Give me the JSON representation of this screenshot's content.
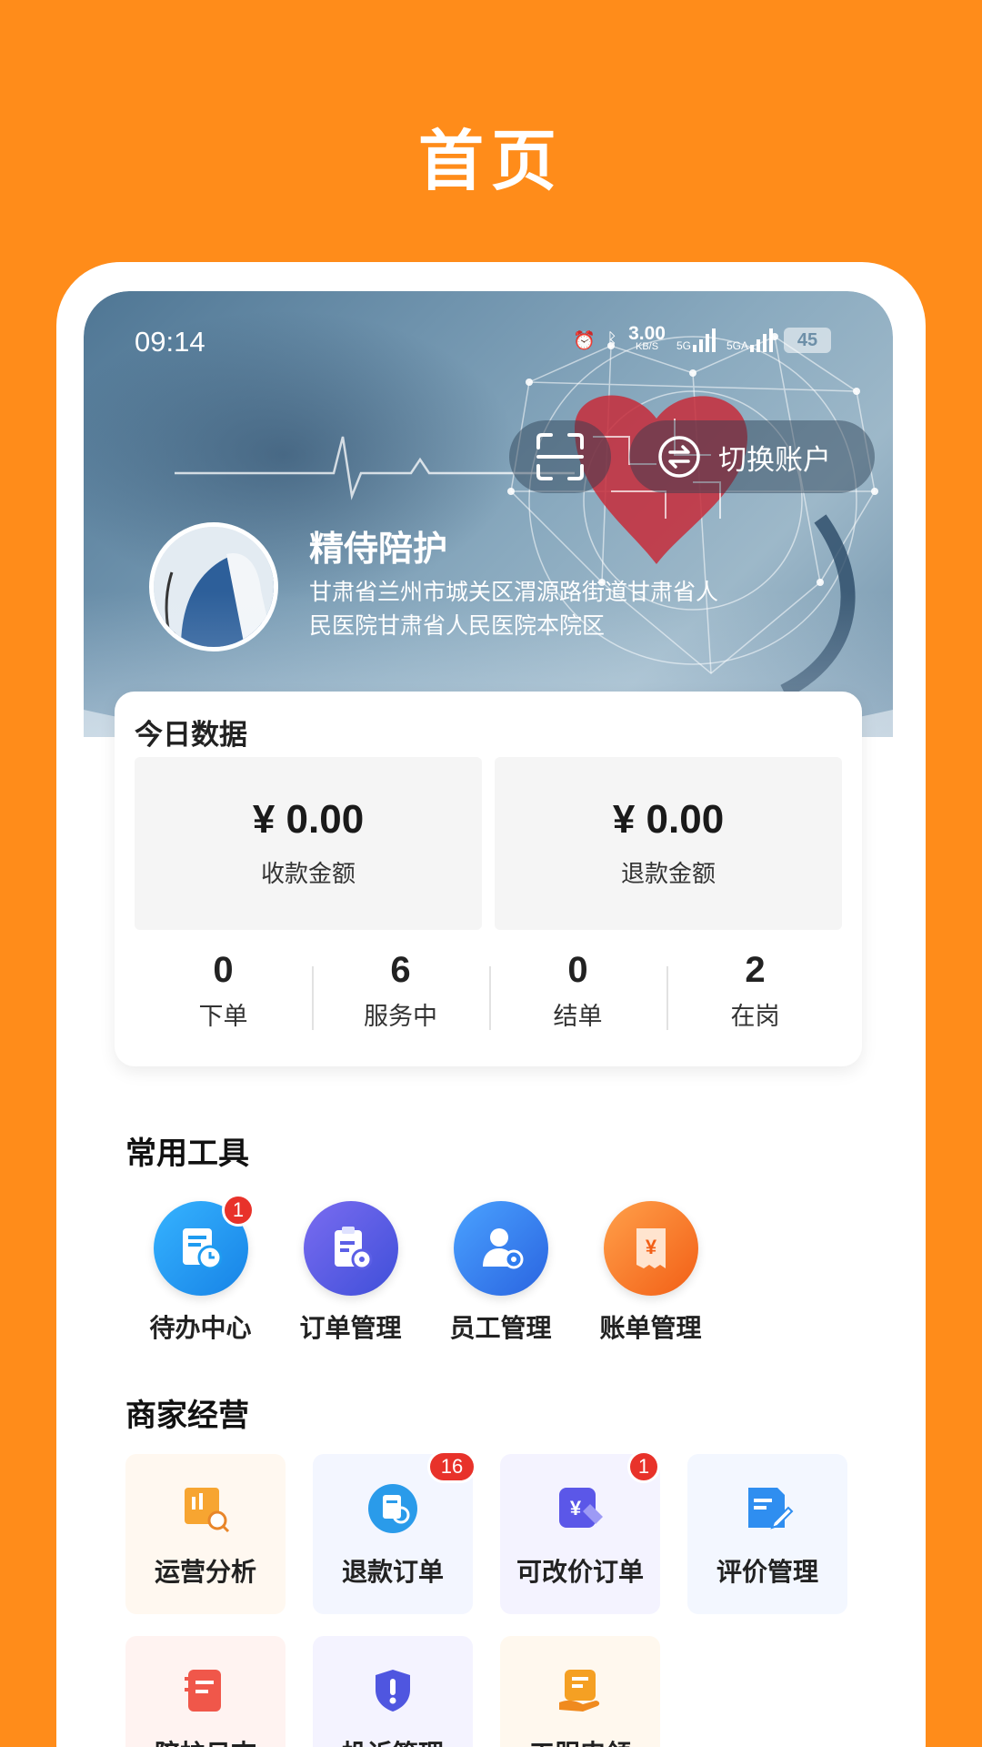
{
  "page": {
    "title": "首页"
  },
  "status_bar": {
    "time": "09:14",
    "speed": "3.00",
    "speed_unit": "KB/S",
    "net1": "5G",
    "net2": "5GA",
    "battery": "45"
  },
  "header": {
    "switch_account_label": "切换账户"
  },
  "shop": {
    "name": "精侍陪护",
    "address": "甘肃省兰州市城关区渭源路街道甘肃省人民医院甘肃省人民医院本院区"
  },
  "today": {
    "title": "今日数据",
    "received_amount": "¥ 0.00",
    "received_label": "收款金额",
    "refund_amount": "¥ 0.00",
    "refund_label": "退款金额",
    "stats": [
      {
        "value": "0",
        "label": "下单"
      },
      {
        "value": "6",
        "label": "服务中"
      },
      {
        "value": "0",
        "label": "结单"
      },
      {
        "value": "2",
        "label": "在岗"
      }
    ]
  },
  "tools": {
    "title": "常用工具",
    "items": [
      {
        "label": "待办中心",
        "badge": "1",
        "icon": "todo-clock-icon",
        "color": "#1E9BF0"
      },
      {
        "label": "订单管理",
        "badge": "",
        "icon": "clipboard-gear-icon",
        "color": "#5B5FE6"
      },
      {
        "label": "员工管理",
        "badge": "",
        "icon": "user-gear-icon",
        "color": "#2F7DF0"
      },
      {
        "label": "账单管理",
        "badge": "",
        "icon": "yen-bill-icon",
        "color": "#F7771E"
      }
    ]
  },
  "business": {
    "title": "商家经营",
    "items": [
      {
        "label": "运营分析",
        "badge": "",
        "icon": "analysis-icon"
      },
      {
        "label": "退款订单",
        "badge": "16",
        "icon": "refund-icon"
      },
      {
        "label": "可改价订单",
        "badge": "1",
        "icon": "price-edit-icon"
      },
      {
        "label": "评价管理",
        "badge": "",
        "icon": "review-edit-icon"
      },
      {
        "label": "陪护日志",
        "badge": "",
        "icon": "care-log-icon"
      },
      {
        "label": "投诉管理",
        "badge": "",
        "icon": "complaint-icon"
      },
      {
        "label": "工服申领",
        "badge": "",
        "icon": "uniform-claim-icon"
      }
    ]
  }
}
